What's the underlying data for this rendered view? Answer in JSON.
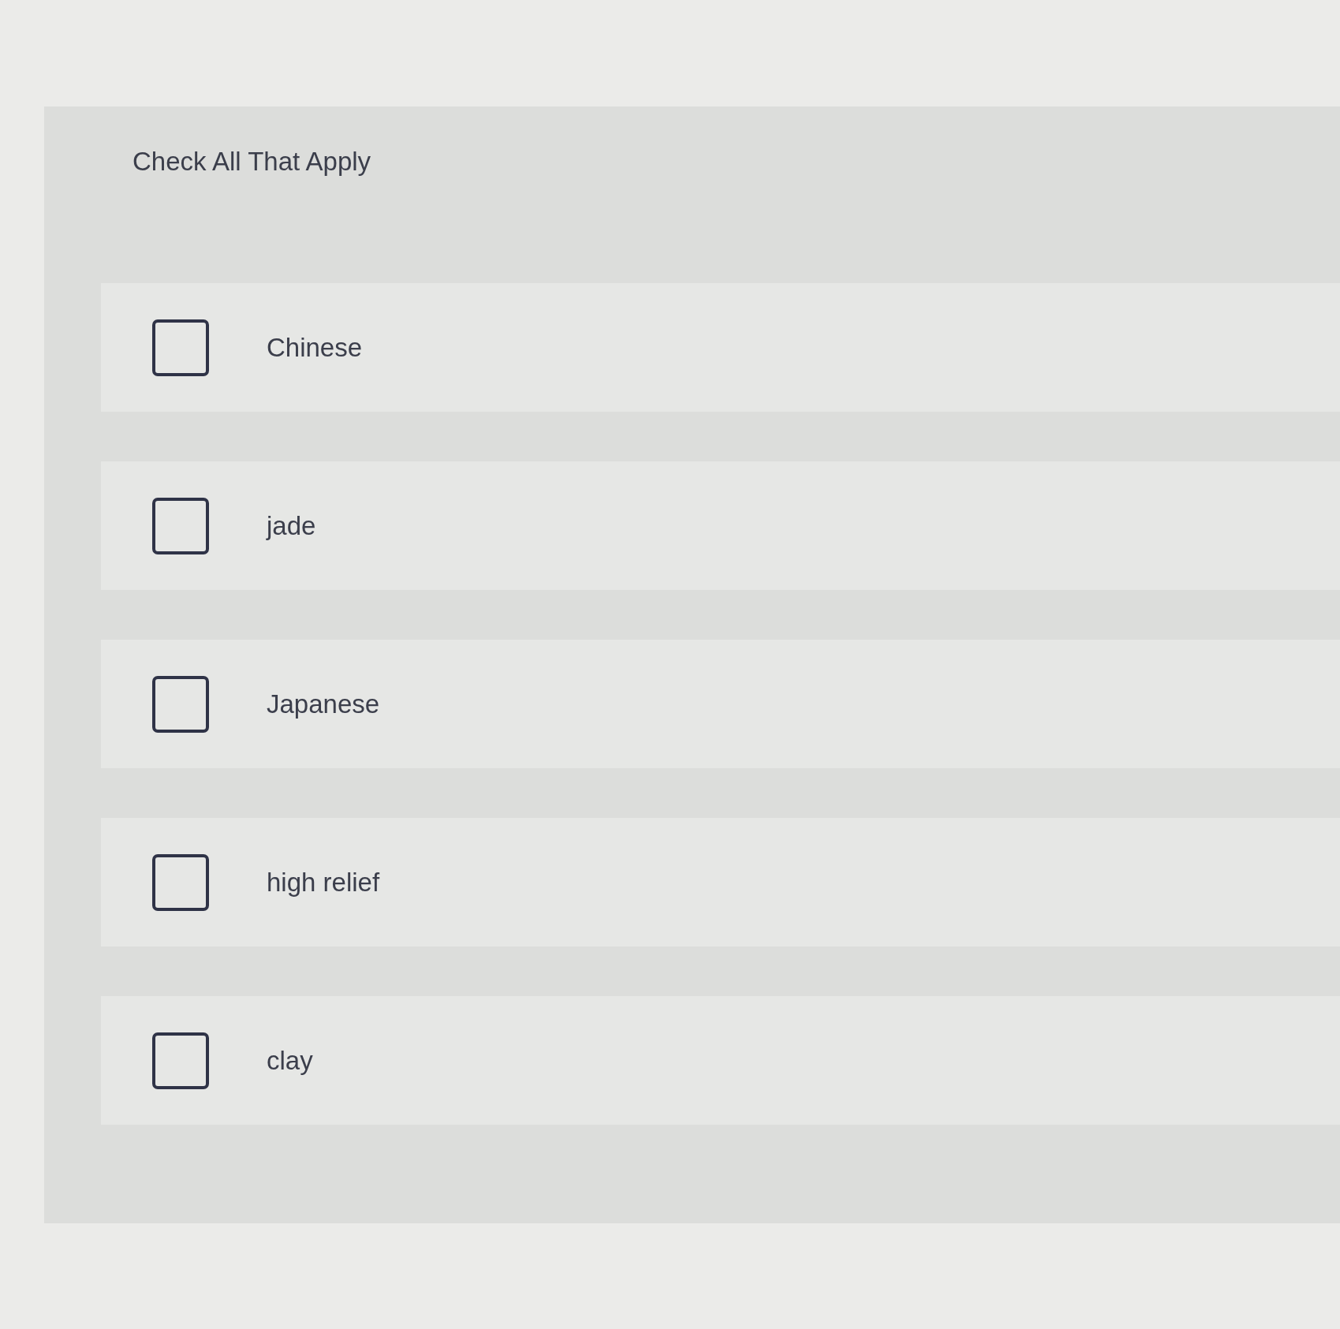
{
  "question": {
    "instruction": "Check All That Apply",
    "options": [
      {
        "label": "Chinese",
        "checked": false
      },
      {
        "label": "jade",
        "checked": false
      },
      {
        "label": "Japanese",
        "checked": false
      },
      {
        "label": "high relief",
        "checked": false
      },
      {
        "label": "clay",
        "checked": false
      }
    ]
  }
}
